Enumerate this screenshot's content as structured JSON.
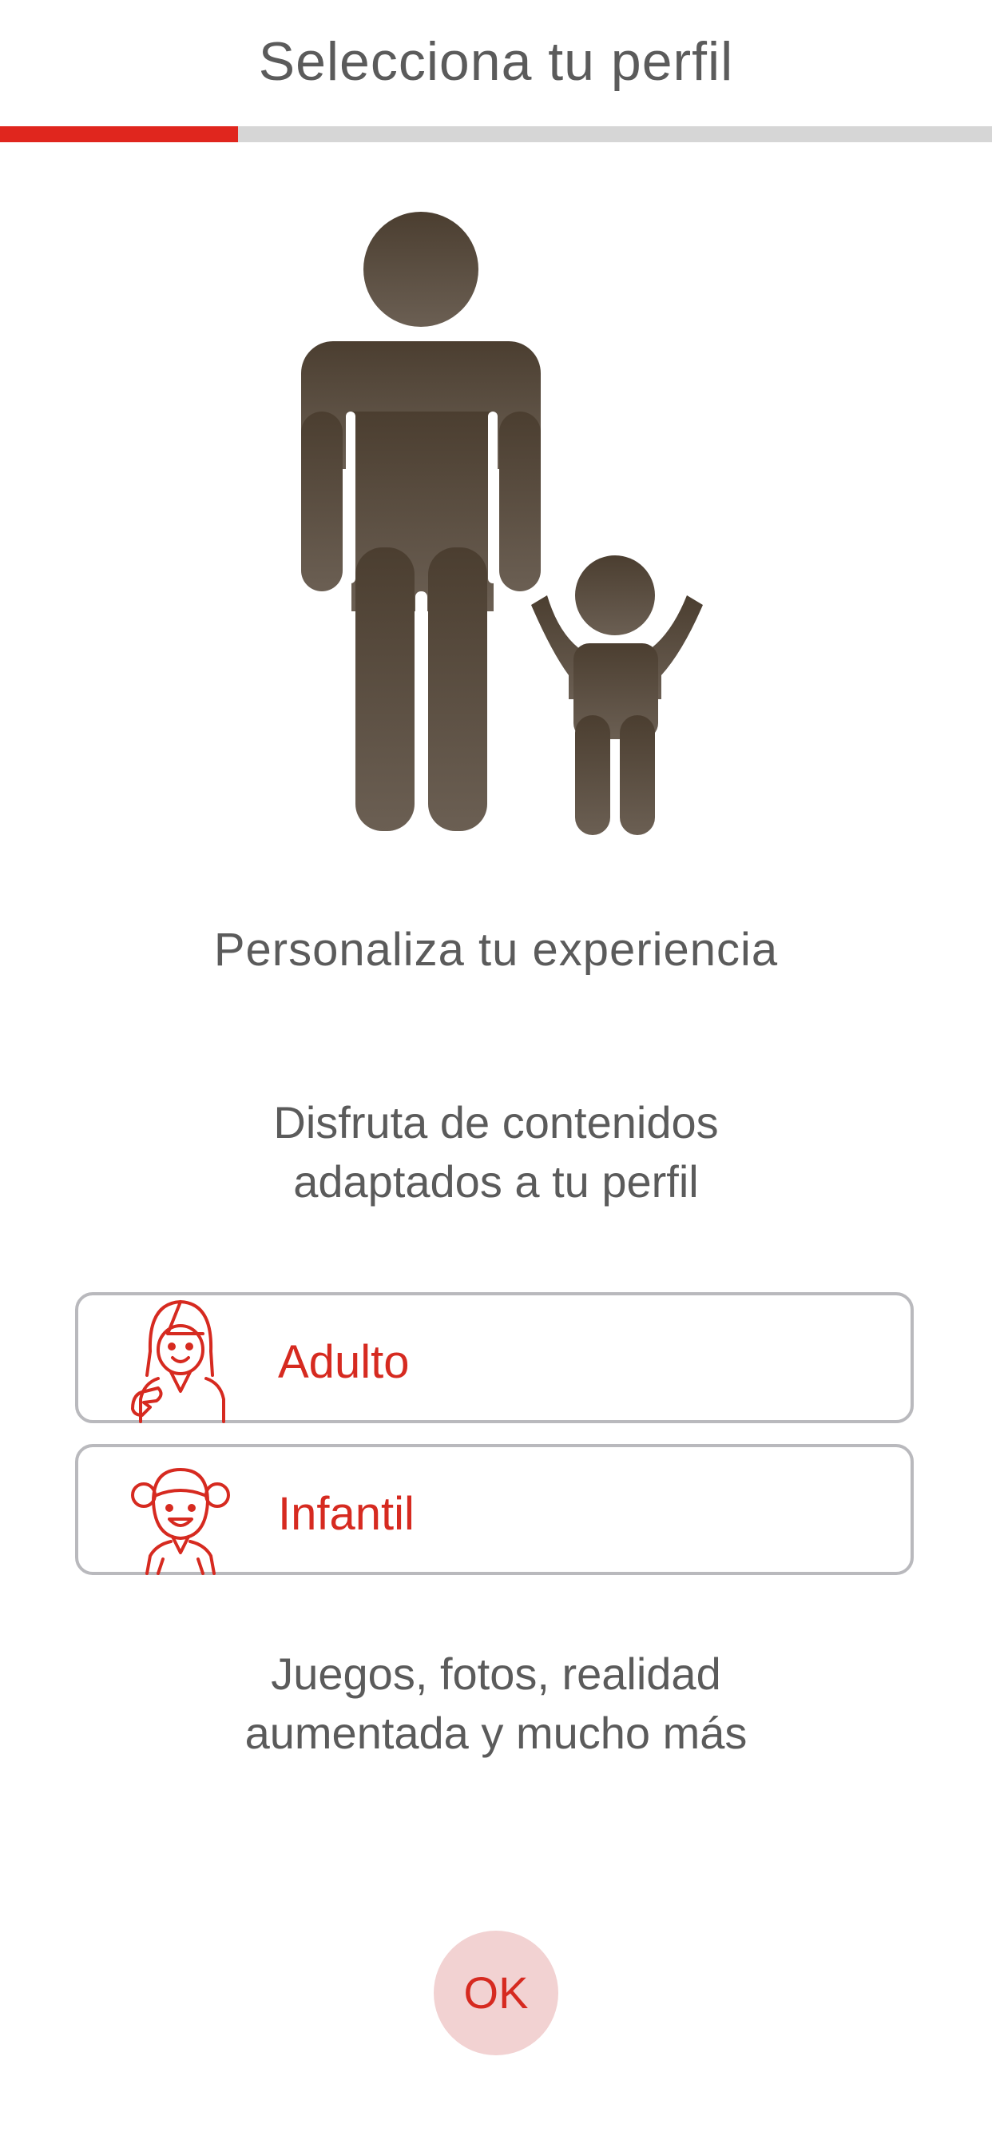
{
  "header": {
    "title": "Selecciona tu perfil",
    "progress": 0.24
  },
  "hero": {
    "icon": "parent-child-icon"
  },
  "main": {
    "subtitle": "Personaliza tu experiencia",
    "description_lines": [
      "Disfruta de contenidos",
      "adaptados a tu perfil"
    ],
    "options": [
      {
        "label": "Adulto",
        "icon": "adult-woman-icon"
      },
      {
        "label": "Infantil",
        "icon": "child-girl-icon"
      }
    ],
    "footer_lines": [
      "Juegos, fotos, realidad",
      "aumentada y mucho más"
    ]
  },
  "actions": {
    "ok_label": "OK"
  },
  "colors": {
    "accent": "#e0261e",
    "text": "#5b5b5b",
    "option_text": "#d62a20",
    "ok_background": "#f2d2d2"
  }
}
